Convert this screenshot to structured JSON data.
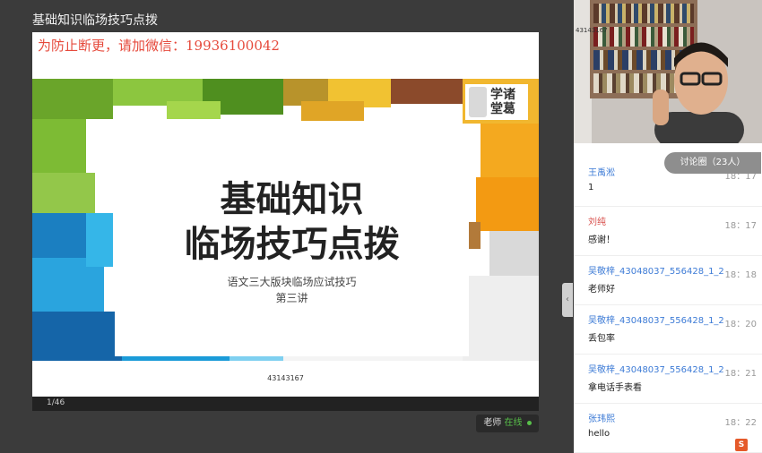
{
  "window": {
    "title": "基础知识临场技巧点拨"
  },
  "slide": {
    "watermark": "为防止断更，请加微信：19936100042",
    "logo_text_line1": "学诸",
    "logo_text_line2": "堂葛",
    "title_line1": "基础知识",
    "title_line2": "临场技巧点拨",
    "subtitle": "语文三大版块临场应试技巧",
    "lecture": "第三讲",
    "footer_id": "43143167"
  },
  "pager": {
    "page": "1/46"
  },
  "teacher_status": {
    "label": "老师",
    "status": "在线"
  },
  "video": {
    "overlay_id": "43143167"
  },
  "discussion": {
    "label": "讨论圈（23人）",
    "messages": [
      {
        "name": "王禹淞",
        "time": "18：17",
        "text": "1"
      },
      {
        "name": "刘纯",
        "time": "18：17",
        "text": "感谢！"
      },
      {
        "name": "吴敬梓_43048037_556428_1_2",
        "time": "18：18",
        "text": "老师好"
      },
      {
        "name": "吴敬梓_43048037_556428_1_2",
        "time": "18：20",
        "text": "丢包率"
      },
      {
        "name": "吴敬梓_43048037_556428_1_2",
        "time": "18：21",
        "text": "拿电话手表看"
      },
      {
        "name": "张玮熙",
        "time": "18：22",
        "text": "hello"
      }
    ]
  },
  "colors": {
    "accent_name": "#3d7bd6",
    "alt_name": "#d9534f",
    "online": "#58c04a",
    "watermark": "#e64a3c"
  }
}
